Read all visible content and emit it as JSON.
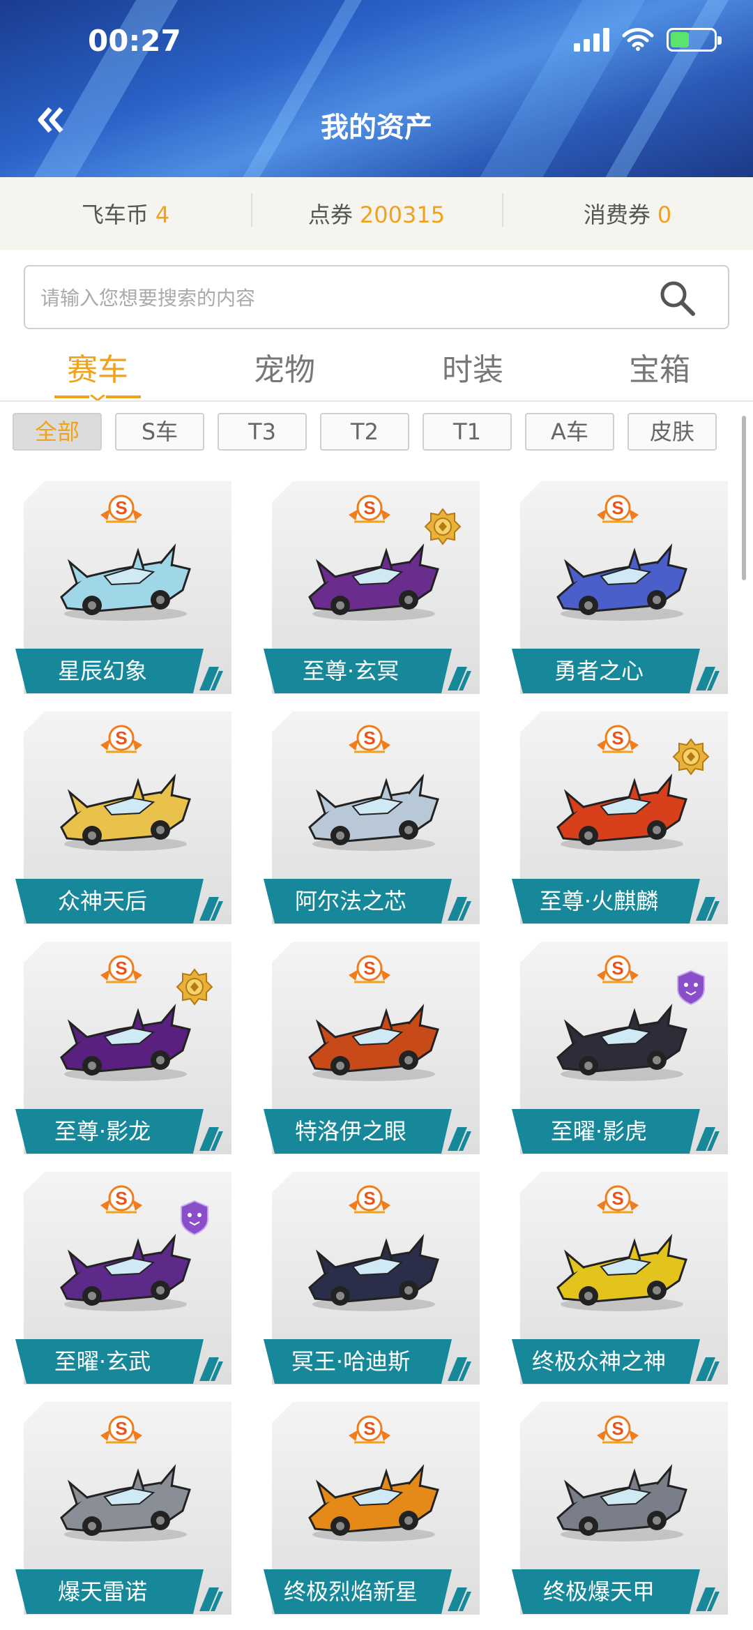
{
  "status": {
    "time": "00:27"
  },
  "header": {
    "back_icon": "double-chevron-left-icon",
    "title": "我的资产"
  },
  "balances": [
    {
      "label": "飞车币",
      "value": "4"
    },
    {
      "label": "点券",
      "value": "200315"
    },
    {
      "label": "消费券",
      "value": "0"
    }
  ],
  "search": {
    "placeholder": "请输入您想要搜索的内容"
  },
  "tabs": [
    {
      "label": "赛车",
      "active": true
    },
    {
      "label": "宠物",
      "active": false
    },
    {
      "label": "时装",
      "active": false
    },
    {
      "label": "宝箱",
      "active": false
    }
  ],
  "filters": [
    {
      "label": "全部",
      "active": true
    },
    {
      "label": "S车",
      "active": false
    },
    {
      "label": "T3",
      "active": false
    },
    {
      "label": "T2",
      "active": false
    },
    {
      "label": "T1",
      "active": false
    },
    {
      "label": "A车",
      "active": false
    },
    {
      "label": "皮肤",
      "active": false
    }
  ],
  "colors": {
    "accent": "#f0a21a",
    "label_bg": "#16889a"
  },
  "cars": [
    {
      "name": "星辰幻象",
      "badge": "none",
      "color": "#9fd6e8"
    },
    {
      "name": "至尊·玄冥",
      "badge": "gold",
      "color": "#6a2d8e"
    },
    {
      "name": "勇者之心",
      "badge": "none",
      "color": "#4a5fc9"
    },
    {
      "name": "众神天后",
      "badge": "none",
      "color": "#e8c24a"
    },
    {
      "name": "阿尔法之芯",
      "badge": "none",
      "color": "#b8c8d6"
    },
    {
      "name": "至尊·火麒麟",
      "badge": "gold",
      "color": "#d8401c"
    },
    {
      "name": "至尊·影龙",
      "badge": "gold",
      "color": "#5a2080"
    },
    {
      "name": "特洛伊之眼",
      "badge": "none",
      "color": "#c84a18"
    },
    {
      "name": "至曜·影虎",
      "badge": "purple",
      "color": "#2d2d3a"
    },
    {
      "name": "至曜·玄武",
      "badge": "purple",
      "color": "#5e2a8a"
    },
    {
      "name": "冥王·哈迪斯",
      "badge": "none",
      "color": "#2a2e48"
    },
    {
      "name": "终极众神之神",
      "badge": "none",
      "color": "#e2c41c"
    },
    {
      "name": "爆天雷诺",
      "badge": "none",
      "color": "#8a8e96"
    },
    {
      "name": "终极烈焰新星",
      "badge": "none",
      "color": "#e58a18"
    },
    {
      "name": "终极爆天甲",
      "badge": "none",
      "color": "#7a7e88"
    }
  ]
}
